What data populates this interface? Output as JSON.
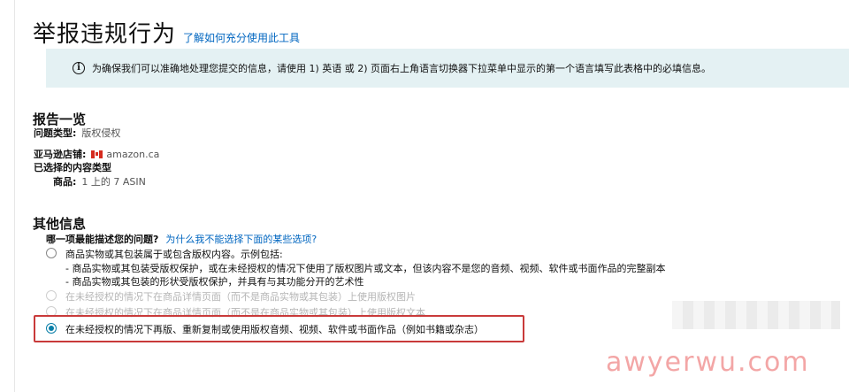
{
  "header": {
    "title": "举报违规行为",
    "help_link": "了解如何充分使用此工具"
  },
  "info_banner": {
    "icon": "info-icon",
    "text": "为确保我们可以准确地处理您提交的信息，请使用 1) 英语 或 2) 页面右上角语言切换器下拉菜单中显示的第一个语言填写此表格中的必填信息。"
  },
  "report_summary": {
    "title": "报告一览",
    "issue_type_label": "问题类型:",
    "issue_type_value": "版权侵权",
    "store_label": "亚马逊店铺:",
    "store_value": "amazon.ca",
    "content_type_label": "已选择的内容类型",
    "product_label": "商品:",
    "product_value": "1 上的 7 ASIN"
  },
  "other_info": {
    "title": "其他信息",
    "question": "哪一项最能描述您的问题?",
    "why_link": "为什么我不能选择下面的某些选项?",
    "options": [
      {
        "label": "商品实物或其包装属于或包含版权内容。示例包括:",
        "sub1": "- 商品实物或其包装受版权保护，或在未经授权的情况下使用了版权图片或文本，但该内容不是您的音频、视频、软件或书面作品的完整副本",
        "sub2": "- 商品实物或其包装的形状受版权保护，并具有与其功能分开的艺术性"
      },
      {
        "label": "在未经授权的情况下在商品详情页面（而不是商品实物或其包装）上使用版权图片"
      },
      {
        "label": "在未经授权的情况下在商品详情页面（而不是在商品实物或其包装）上使用版权文本"
      },
      {
        "label": "在未经授权的情况下再版、重新复制或使用版权音频、视频、软件或书面作品（例如书籍或杂志）"
      }
    ]
  },
  "watermark": "awyerwu.com",
  "colors": {
    "link": "#0066c0",
    "banner_bg": "#e4f1f3",
    "highlight": "#c93a3a",
    "radio_selected": "#0a7fa8"
  }
}
